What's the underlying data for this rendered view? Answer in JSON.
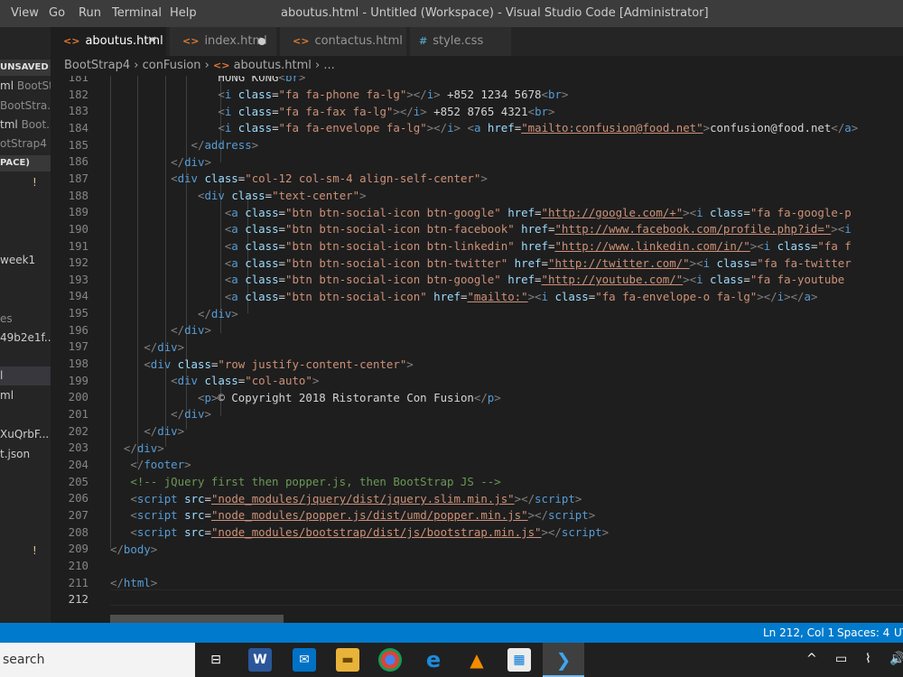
{
  "menubar": {
    "items": [
      "View",
      "Go",
      "Run",
      "Terminal",
      "Help"
    ],
    "window_title": "aboutus.html - Untitled (Workspace) - Visual Studio Code [Administrator]"
  },
  "sidebar": {
    "unsaved_header": "UNSAVED",
    "open_editors": [
      {
        "name": "ml",
        "path": "BootSt..."
      },
      {
        "name": "",
        "path": "BootStra..."
      },
      {
        "name": "tml",
        "path": "Boot..."
      },
      {
        "name": "",
        "path": "otStrap4 ..."
      }
    ],
    "workspace_header": "PACE)",
    "warning": "!",
    "items": [
      "week1",
      "es",
      "49b2e1f...",
      "l",
      "ml",
      "XuQrbF...",
      "t.json"
    ],
    "warning2": "!"
  },
  "tabs": [
    {
      "label": "aboutus.html",
      "icon": "html-icon",
      "active": true,
      "close": "✕"
    },
    {
      "label": "index.html",
      "icon": "html-icon",
      "modified": true
    },
    {
      "label": "contactus.html",
      "icon": "html-icon"
    },
    {
      "label": "style.css",
      "icon": "css-icon",
      "prefix": "#"
    }
  ],
  "breadcrumb": {
    "part1": "BootStrap4",
    "sep": "›",
    "part2": "conFusion",
    "part3": "aboutus.html",
    "part4": "..."
  },
  "editor": {
    "current_line": 212,
    "lines": [
      {
        "n": 181
      },
      {
        "n": 182
      },
      {
        "n": 183
      },
      {
        "n": 184
      },
      {
        "n": 185
      },
      {
        "n": 186
      },
      {
        "n": 187
      },
      {
        "n": 188
      },
      {
        "n": 189
      },
      {
        "n": 190
      },
      {
        "n": 191
      },
      {
        "n": 192
      },
      {
        "n": 193
      },
      {
        "n": 194
      },
      {
        "n": 195
      },
      {
        "n": 196
      },
      {
        "n": 197
      },
      {
        "n": 198
      },
      {
        "n": 199
      },
      {
        "n": 200
      },
      {
        "n": 201
      },
      {
        "n": 202
      },
      {
        "n": 203
      },
      {
        "n": 204
      },
      {
        "n": 205
      },
      {
        "n": 206
      },
      {
        "n": 207
      },
      {
        "n": 208
      },
      {
        "n": 209
      },
      {
        "n": 210
      },
      {
        "n": 211
      },
      {
        "n": 212
      }
    ],
    "code": {
      "l181_text": "HONG KONG",
      "l182_text": " +852 1234 5678",
      "l183_text": " +852 8765 4321",
      "l184_text": "confusion@food.net",
      "l184_href": "\"mailto:confusion@food.net\"",
      "l187_class": "\"col-12 col-sm-4 align-self-center\"",
      "l188_class": "\"text-center\"",
      "l189_class": "\"btn btn-social-icon btn-google\"",
      "l189_href": "\"http://google.com/+\"",
      "l189_iclass": "\"fa fa-google-p",
      "l190_class": "\"btn btn-social-icon btn-facebook\"",
      "l190_href": "\"http://www.facebook.com/profile.php?id=\"",
      "l191_class": "\"btn btn-social-icon btn-linkedin\"",
      "l191_href": "\"http://www.linkedin.com/in/\"",
      "l191_iclass": "\"fa f",
      "l192_class": "\"btn btn-social-icon btn-twitter\"",
      "l192_href": "\"http://twitter.com/\"",
      "l192_iclass": "\"fa fa-twitter",
      "l193_class": "\"btn btn-social-icon btn-google\"",
      "l193_href": "\"http://youtube.com/\"",
      "l193_iclass": "\"fa fa-youtube",
      "l194_class": "\"btn btn-social-icon\"",
      "l194_href": "\"mailto:\"",
      "l194_iclass": "\"fa fa-envelope-o fa-lg\"",
      "l198_class": "\"row justify-content-center\"",
      "l199_class": "\"col-auto\"",
      "l200_text": "© Copyright 2018 Ristorante Con Fusion",
      "l205_comment": "<!-- jQuery first then popper.js, then BootStrap JS -->",
      "l206_src": "\"node_modules/jquery/dist/jquery.slim.min.js\"",
      "l207_src": "\"node_modules/popper.js/dist/umd/popper.min.js\"",
      "l208_src": "\"node_modules/bootstrap/dist/js/bootstrap.min.js\"",
      "phone_class": "\"fa fa-phone fa-lg\"",
      "fax_class": "\"fa fa-fax fa-lg\"",
      "envelope_class": "\"fa fa-envelope fa-lg\""
    }
  },
  "statusbar": {
    "position": "Ln 212, Col 1",
    "spaces": "Spaces: 4",
    "encoding": "UT"
  },
  "taskbar": {
    "search_label": "search",
    "icons": [
      "task-view-icon",
      "word-icon",
      "mail-icon",
      "file-explorer-icon",
      "chrome-icon",
      "edge-icon",
      "vlc-icon",
      "store-icon",
      "vscode-icon"
    ],
    "tray": [
      "^",
      "▭",
      "⌇",
      "🔊"
    ]
  },
  "colors": {
    "accent": "#007acc",
    "editor_bg": "#1e1e1e",
    "tag": "#569cd6",
    "attr": "#9cdcfe",
    "string": "#ce9178",
    "comment": "#6a9955"
  }
}
